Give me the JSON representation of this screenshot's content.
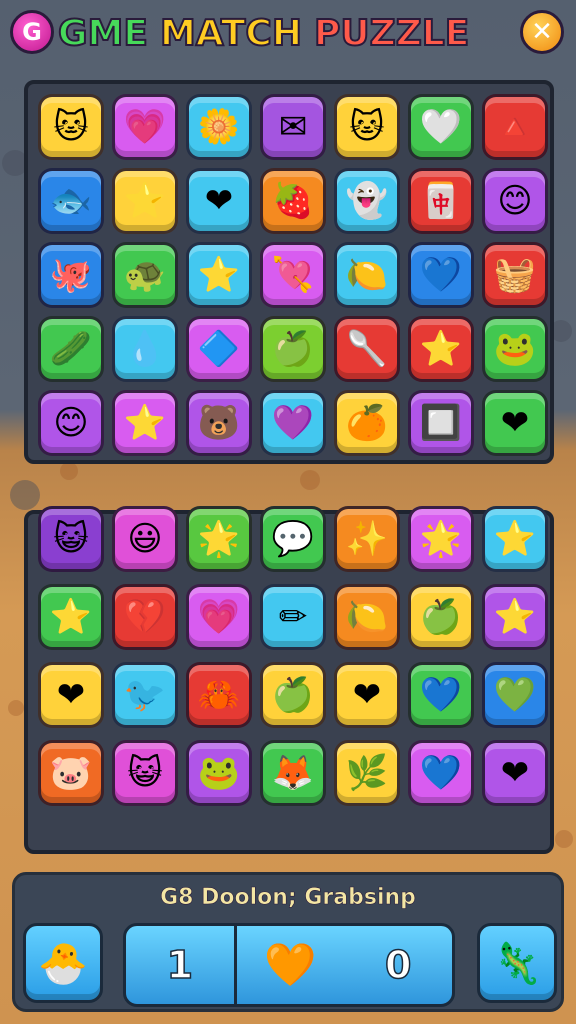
{
  "header": {
    "logo_glyph": "G",
    "title_word1": "GME",
    "title_word2": "MATCH",
    "title_word3": "PUZZLE",
    "close_glyph": "✕"
  },
  "top_board": {
    "tiles": [
      {
        "color": "#ffd23a",
        "icon": "🐱"
      },
      {
        "color": "#d85cf0",
        "icon": "💗"
      },
      {
        "color": "#43c8f0",
        "icon": "🌼"
      },
      {
        "color": "#a455e0",
        "icon": "✉"
      },
      {
        "color": "#ffd23a",
        "icon": "🐱"
      },
      {
        "color": "#42c850",
        "icon": "🤍"
      },
      {
        "color": "#e63a34",
        "icon": "🔺"
      },
      {
        "color": "#2a86e8",
        "icon": "🐟"
      },
      {
        "color": "#ffd23a",
        "icon": "⭐"
      },
      {
        "color": "#43c8f0",
        "icon": "❤"
      },
      {
        "color": "#f58a20",
        "icon": "🍓"
      },
      {
        "color": "#43c8f0",
        "icon": "👻"
      },
      {
        "color": "#e63a34",
        "icon": "🀄"
      },
      {
        "color": "#b055e8",
        "icon": "😊"
      },
      {
        "color": "#2a86e8",
        "icon": "🐙"
      },
      {
        "color": "#42c850",
        "icon": "🐢"
      },
      {
        "color": "#43c8f0",
        "icon": "⭐"
      },
      {
        "color": "#d85cf0",
        "icon": "💘"
      },
      {
        "color": "#43c8f0",
        "icon": "🍋"
      },
      {
        "color": "#2a86e8",
        "icon": "💙"
      },
      {
        "color": "#e63a34",
        "icon": "🧺"
      },
      {
        "color": "#42c850",
        "icon": "🥒"
      },
      {
        "color": "#43c8f0",
        "icon": "💧"
      },
      {
        "color": "#d85cf0",
        "icon": "🔷"
      },
      {
        "color": "#7ccf30",
        "icon": "🍏"
      },
      {
        "color": "#e63a34",
        "icon": "🥄"
      },
      {
        "color": "#e63a34",
        "icon": "⭐"
      },
      {
        "color": "#42c850",
        "icon": "🐸"
      },
      {
        "color": "#b055e8",
        "icon": "😊"
      },
      {
        "color": "#d85cf0",
        "icon": "⭐"
      },
      {
        "color": "#b055e8",
        "icon": "🐻"
      },
      {
        "color": "#43c8f0",
        "icon": "💜"
      },
      {
        "color": "#ffd23a",
        "icon": "🍊"
      },
      {
        "color": "#b055e8",
        "icon": "🔲"
      },
      {
        "color": "#42c850",
        "icon": "❤"
      }
    ]
  },
  "bottom_board": {
    "tiles": [
      {
        "color": "#8a3fd0",
        "icon": "😺"
      },
      {
        "color": "#e050d8",
        "icon": "😃"
      },
      {
        "color": "#58c840",
        "icon": "🌟"
      },
      {
        "color": "#42c850",
        "icon": "💬"
      },
      {
        "color": "#f58a20",
        "icon": "✨"
      },
      {
        "color": "#d85cf0",
        "icon": "🌟"
      },
      {
        "color": "#43c8f0",
        "icon": "⭐"
      },
      {
        "color": "#42c850",
        "icon": "⭐"
      },
      {
        "color": "#e63a34",
        "icon": "💔"
      },
      {
        "color": "#d85cf0",
        "icon": "💗"
      },
      {
        "color": "#43c8f0",
        "icon": "✏"
      },
      {
        "color": "#f58a20",
        "icon": "🍋"
      },
      {
        "color": "#ffd23a",
        "icon": "🍏"
      },
      {
        "color": "#b055e8",
        "icon": "⭐"
      },
      {
        "color": "#ffd23a",
        "icon": "❤"
      },
      {
        "color": "#43c8f0",
        "icon": "🐦"
      },
      {
        "color": "#e63a34",
        "icon": "🦀"
      },
      {
        "color": "#ffd23a",
        "icon": "🍏"
      },
      {
        "color": "#ffd23a",
        "icon": "❤"
      },
      {
        "color": "#42c850",
        "icon": "💙"
      },
      {
        "color": "#2a86e8",
        "icon": "💚"
      },
      {
        "color": "#f06a24",
        "icon": "🐷"
      },
      {
        "color": "#e050d8",
        "icon": "😺"
      },
      {
        "color": "#b055e8",
        "icon": "🐸"
      },
      {
        "color": "#42c850",
        "icon": "🦊"
      },
      {
        "color": "#ffd23a",
        "icon": "🌿"
      },
      {
        "color": "#d85cf0",
        "icon": "💙"
      },
      {
        "color": "#b055e8",
        "icon": "❤"
      }
    ]
  },
  "bottom_bar": {
    "status_text": "G8 Doolon; Grabsinp",
    "left_button_icon": "🐣",
    "score_left": "1",
    "score_mid_icon": "🧡",
    "score_right": "0",
    "right_button_icon": "🦎"
  }
}
